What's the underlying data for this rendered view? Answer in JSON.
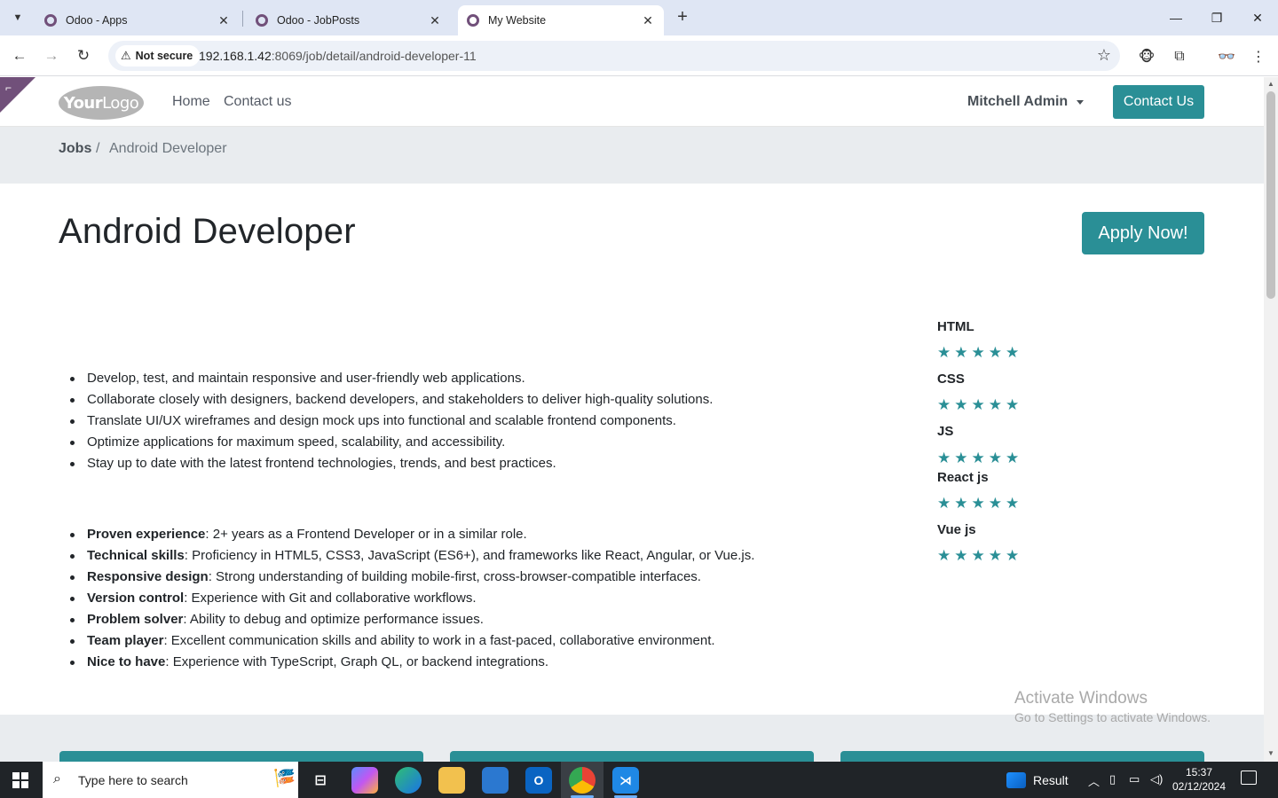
{
  "browser": {
    "tabs": [
      {
        "title": "Odoo - Apps",
        "active": false
      },
      {
        "title": "Odoo - JobPosts",
        "active": false
      },
      {
        "title": "My Website",
        "active": true
      }
    ],
    "security_label": "Not secure",
    "url_host": "192.168.1.42",
    "url_rest": ":8069/job/detail/android-developer-11"
  },
  "site": {
    "logo_bold": "Your",
    "logo_thin": "Logo",
    "menu": [
      "Home",
      "Contact us"
    ],
    "user": "Mitchell Admin",
    "contact_button": "Contact Us"
  },
  "breadcrumb": {
    "root": "Jobs",
    "separator": "/",
    "current": "Android Developer"
  },
  "job": {
    "title": "Android Developer",
    "apply_button": "Apply Now!",
    "responsibilities": [
      "Develop, test, and maintain responsive and user-friendly web applications.",
      "Collaborate closely with designers, backend developers, and stakeholders to deliver high-quality solutions.",
      "Translate UI/UX wireframes and design mock ups into functional and scalable frontend components.",
      "Optimize applications for maximum speed, scalability, and accessibility.",
      "Stay up to date with the latest frontend technologies, trends, and best practices."
    ],
    "requirements": [
      {
        "label": "Proven experience",
        "text": ": 2+ years as a Frontend Developer or in a similar role."
      },
      {
        "label": "Technical skills",
        "text": ": Proficiency in HTML5, CSS3, JavaScript (ES6+), and frameworks like React, Angular, or Vue.js."
      },
      {
        "label": "Responsive design",
        "text": ": Strong understanding of building mobile-first, cross-browser-compatible interfaces."
      },
      {
        "label": "Version control",
        "text": ": Experience with Git and collaborative workflows."
      },
      {
        "label": "Problem solver",
        "text": ": Ability to debug and optimize performance issues."
      },
      {
        "label": "Team player",
        "text": ": Excellent communication skills and ability to work in a fast-paced, collaborative environment."
      },
      {
        "label": "Nice to have",
        "text": ": Experience with TypeScript, Graph QL, or backend integrations."
      }
    ],
    "skills": [
      {
        "name": "HTML",
        "rating": 5
      },
      {
        "name": "CSS",
        "rating": 5
      },
      {
        "name": "JS",
        "rating": 5
      },
      {
        "name": "React js",
        "rating": 5
      },
      {
        "name": "Vue js",
        "rating": 5
      }
    ]
  },
  "watermark": {
    "line1": "Activate Windows",
    "line2": "Go to Settings to activate Windows."
  },
  "taskbar": {
    "search_placeholder": "Type here to search",
    "weather_label": "Result",
    "time": "15:37",
    "date": "02/12/2024"
  },
  "colors": {
    "accent": "#2a8f96",
    "odoo_purple": "#71507a",
    "breadcrumb_bg": "#e9ecef"
  }
}
